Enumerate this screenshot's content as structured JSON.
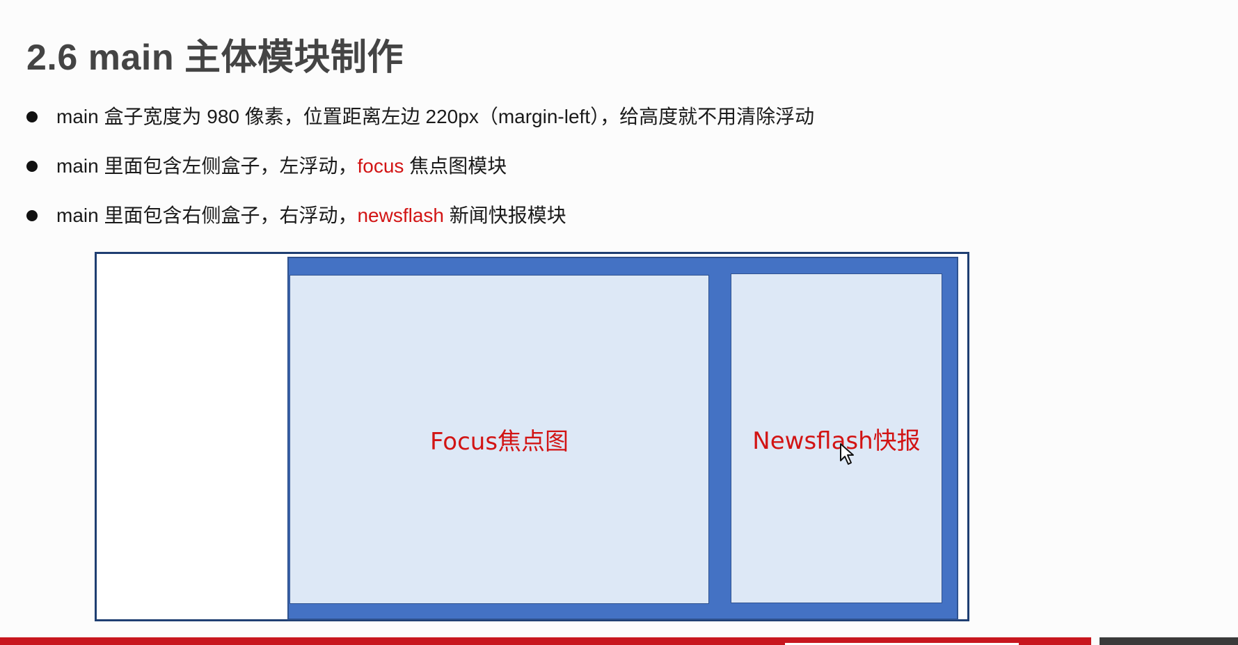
{
  "title": "2.6 main 主体模块制作",
  "bullets": [
    {
      "parts": [
        "main 盒子宽度为 980 像素，位置距离左边 220px（margin-left），给高度就不用清除浮动",
        "",
        ""
      ]
    },
    {
      "parts": [
        "main 里面包含左侧盒子，左浮动，",
        "focus",
        " 焦点图模块"
      ]
    },
    {
      "parts": [
        "main 里面包含右侧盒子，右浮动，",
        "newsflash",
        " 新闻快报模块"
      ]
    }
  ],
  "diagram": {
    "focus_label": "Focus焦点图",
    "newsflash_label": "Newsflash快报"
  },
  "colors": {
    "title": "#444444",
    "highlight": "#d21414",
    "main_box": "#4472c4",
    "inner_box": "#dde8f6",
    "outer_border": "#1f3f72",
    "bottom_bar": "#c8161e"
  },
  "icons": {
    "cursor": "mouse-pointer-icon"
  }
}
